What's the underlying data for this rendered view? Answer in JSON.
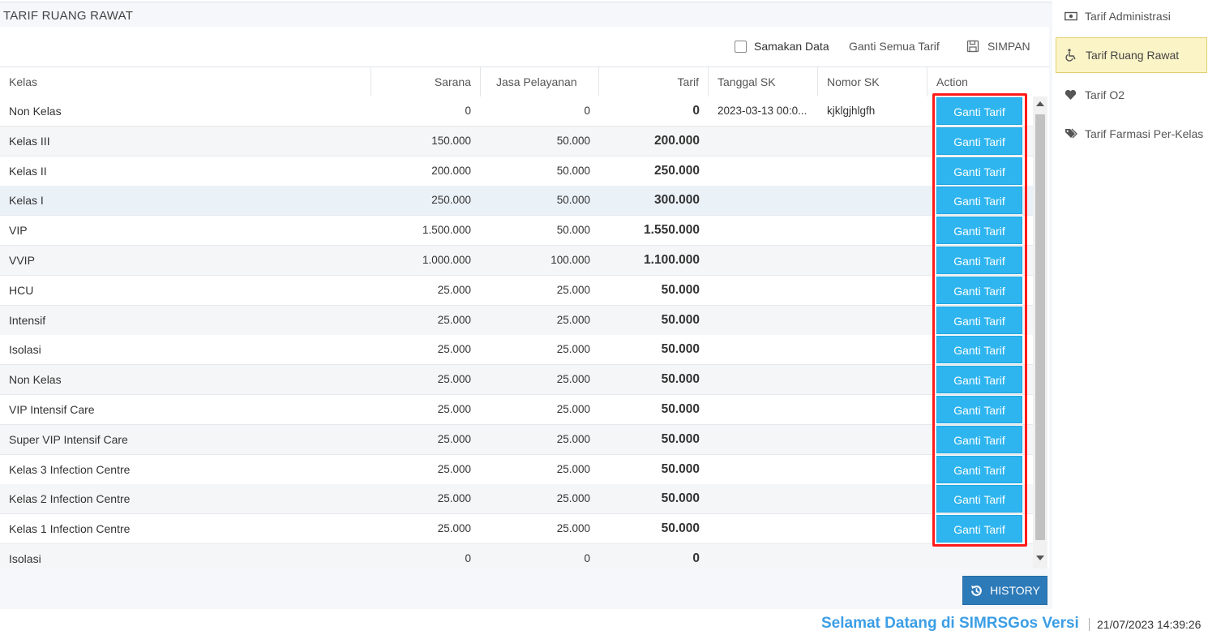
{
  "panel": {
    "title": "TARIF RUANG RAWAT"
  },
  "toolbar": {
    "samakan_label": "Samakan Data",
    "samakan_checked": false,
    "ganti_semua_label": "Ganti Semua Tarif",
    "simpan_label": "SIMPAN"
  },
  "grid": {
    "columns": [
      "Kelas",
      "Sarana",
      "Jasa Pelayanan",
      "Tarif",
      "Tanggal SK",
      "Nomor SK",
      "Action"
    ],
    "action_label": "Ganti Tarif",
    "rows": [
      {
        "kelas": "Non Kelas",
        "sarana": "0",
        "jasa": "0",
        "tarif": "0",
        "tgl": "2023-03-13 00:0...",
        "nomor": "kjklgjhlgfh",
        "action": "Ganti Tarif"
      },
      {
        "kelas": "Kelas III",
        "sarana": "150.000",
        "jasa": "50.000",
        "tarif": "200.000",
        "tgl": "",
        "nomor": "",
        "action": "Ganti Tarif"
      },
      {
        "kelas": "Kelas II",
        "sarana": "200.000",
        "jasa": "50.000",
        "tarif": "250.000",
        "tgl": "",
        "nomor": "",
        "action": "Ganti Tarif"
      },
      {
        "kelas": "Kelas I",
        "sarana": "250.000",
        "jasa": "50.000",
        "tarif": "300.000",
        "tgl": "",
        "nomor": "",
        "action": "Ganti Tarif"
      },
      {
        "kelas": "VIP",
        "sarana": "1.500.000",
        "jasa": "50.000",
        "tarif": "1.550.000",
        "tgl": "",
        "nomor": "",
        "action": "Ganti Tarif"
      },
      {
        "kelas": "VVIP",
        "sarana": "1.000.000",
        "jasa": "100.000",
        "tarif": "1.100.000",
        "tgl": "",
        "nomor": "",
        "action": "Ganti Tarif"
      },
      {
        "kelas": "HCU",
        "sarana": "25.000",
        "jasa": "25.000",
        "tarif": "50.000",
        "tgl": "",
        "nomor": "",
        "action": "Ganti Tarif"
      },
      {
        "kelas": "Intensif",
        "sarana": "25.000",
        "jasa": "25.000",
        "tarif": "50.000",
        "tgl": "",
        "nomor": "",
        "action": "Ganti Tarif"
      },
      {
        "kelas": "Isolasi",
        "sarana": "25.000",
        "jasa": "25.000",
        "tarif": "50.000",
        "tgl": "",
        "nomor": "",
        "action": "Ganti Tarif"
      },
      {
        "kelas": "Non Kelas",
        "sarana": "25.000",
        "jasa": "25.000",
        "tarif": "50.000",
        "tgl": "",
        "nomor": "",
        "action": "Ganti Tarif"
      },
      {
        "kelas": "VIP Intensif Care",
        "sarana": "25.000",
        "jasa": "25.000",
        "tarif": "50.000",
        "tgl": "",
        "nomor": "",
        "action": "Ganti Tarif"
      },
      {
        "kelas": "Super VIP Intensif Care",
        "sarana": "25.000",
        "jasa": "25.000",
        "tarif": "50.000",
        "tgl": "",
        "nomor": "",
        "action": "Ganti Tarif"
      },
      {
        "kelas": "Kelas 3 Infection Centre",
        "sarana": "25.000",
        "jasa": "25.000",
        "tarif": "50.000",
        "tgl": "",
        "nomor": "",
        "action": "Ganti Tarif"
      },
      {
        "kelas": "Kelas 2 Infection Centre",
        "sarana": "25.000",
        "jasa": "25.000",
        "tarif": "50.000",
        "tgl": "",
        "nomor": "",
        "action": "Ganti Tarif"
      },
      {
        "kelas": "Kelas 1 Infection Centre",
        "sarana": "25.000",
        "jasa": "25.000",
        "tarif": "50.000",
        "tgl": "",
        "nomor": "",
        "action": "Ganti Tarif"
      },
      {
        "kelas": "Isolasi",
        "sarana": "0",
        "jasa": "0",
        "tarif": "0",
        "tgl": "",
        "nomor": "",
        "action": ""
      }
    ]
  },
  "footer": {
    "history_label": "HISTORY"
  },
  "sidebar": {
    "items": [
      {
        "label": "Tarif Administrasi",
        "icon": "money-icon",
        "active": false
      },
      {
        "label": "Tarif Ruang Rawat",
        "icon": "wheelchair-icon",
        "active": true
      },
      {
        "label": "Tarif O2",
        "icon": "heart-icon",
        "active": false
      },
      {
        "label": "Tarif Farmasi Per-Kelas",
        "icon": "tags-icon",
        "active": false
      }
    ]
  },
  "status": {
    "welcome": "Selamat Datang di SIMRSGos Versi",
    "datetime": "21/07/2023 14:39:26"
  },
  "colors": {
    "action_button": "#2eb5ef",
    "history_button": "#2d7ab8",
    "highlight_box": "#ff1a1a",
    "active_sidebar": "#fbf4c7",
    "welcome_text": "#3b9ee6"
  }
}
